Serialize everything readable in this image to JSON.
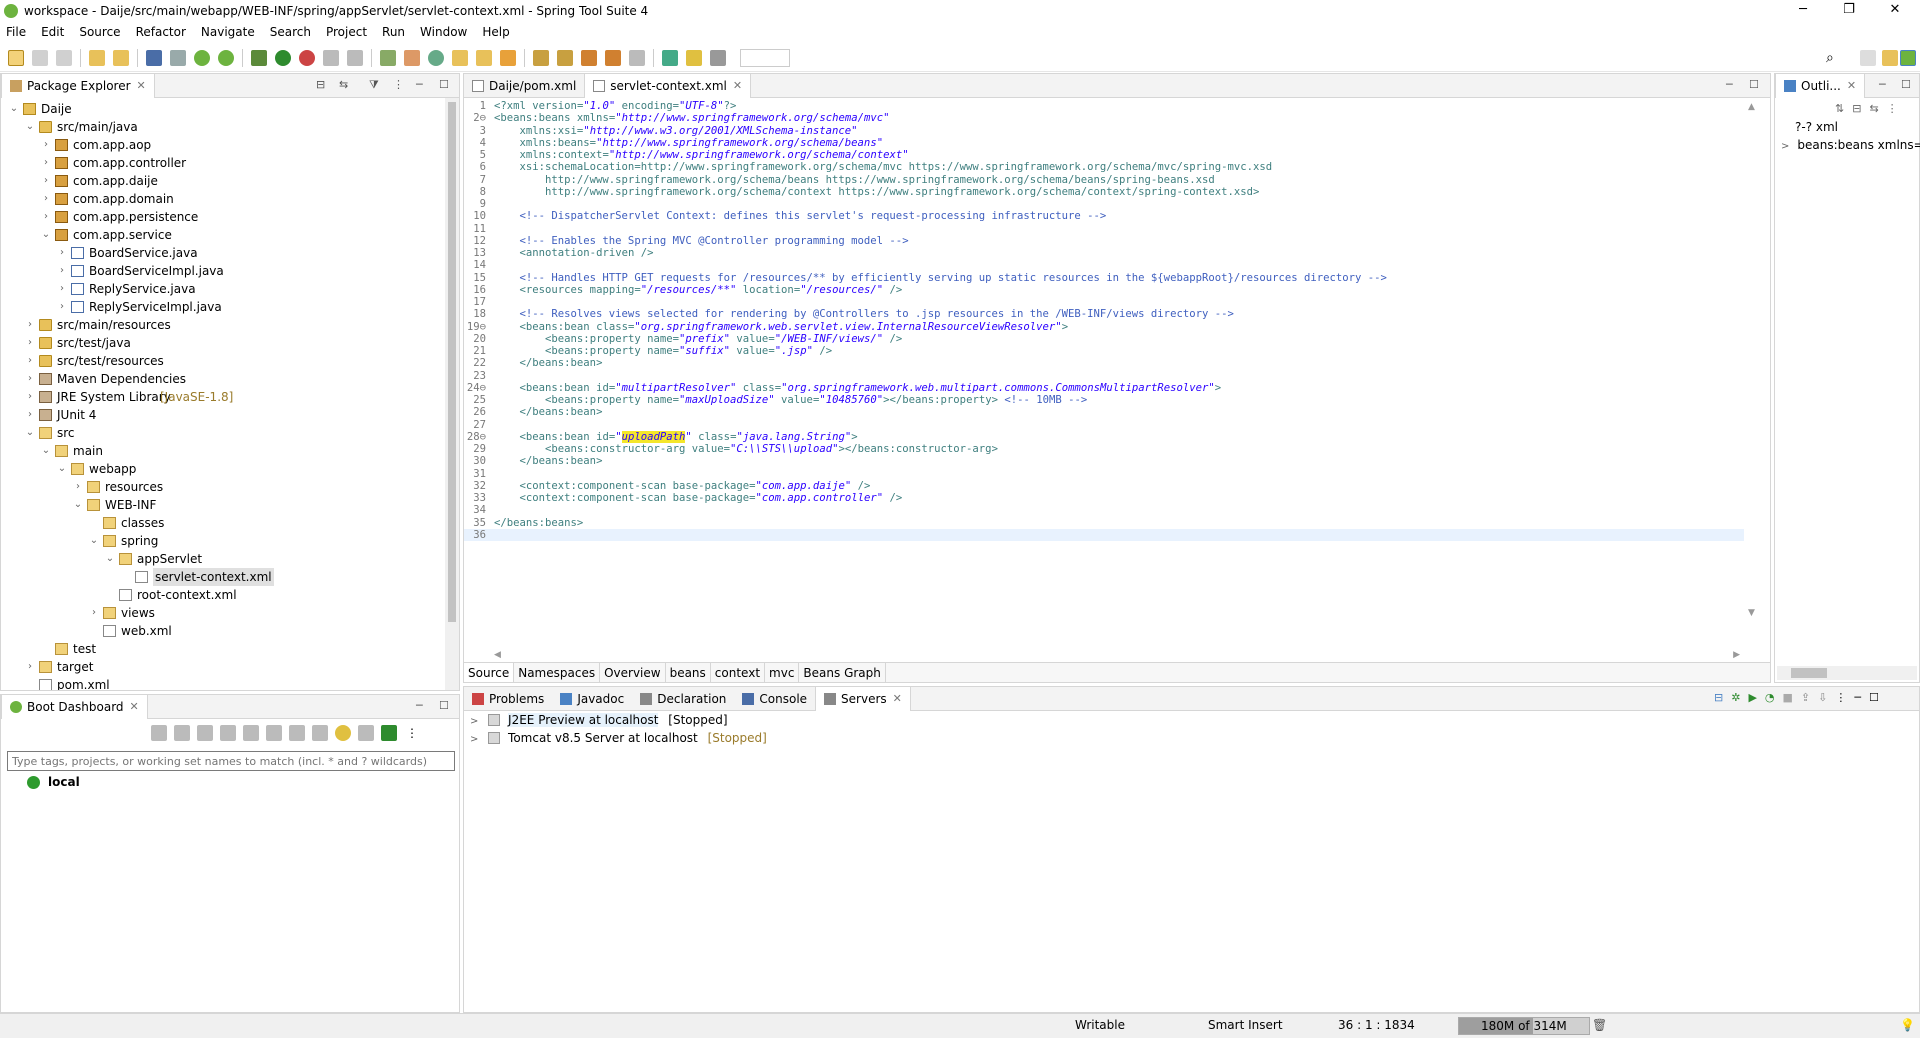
{
  "window": {
    "title": "workspace - Daije/src/main/webapp/WEB-INF/spring/appServlet/servlet-context.xml - Spring Tool Suite 4",
    "minimize": "─",
    "restore": "❐",
    "close": "✕"
  },
  "menu": [
    "File",
    "Edit",
    "Source",
    "Refactor",
    "Navigate",
    "Search",
    "Project",
    "Run",
    "Window",
    "Help"
  ],
  "package_explorer": {
    "title": "Package Explorer",
    "tree": [
      {
        "label": "Daije",
        "depth": 0,
        "icon": "project",
        "arrow": "v"
      },
      {
        "label": "src/main/java",
        "depth": 1,
        "icon": "srcfolder",
        "arrow": "v"
      },
      {
        "label": "com.app.aop",
        "depth": 2,
        "icon": "pkg",
        "arrow": ">"
      },
      {
        "label": "com.app.controller",
        "depth": 2,
        "icon": "pkg",
        "arrow": ">"
      },
      {
        "label": "com.app.daije",
        "depth": 2,
        "icon": "pkg",
        "arrow": ">"
      },
      {
        "label": "com.app.domain",
        "depth": 2,
        "icon": "pkg",
        "arrow": ">"
      },
      {
        "label": "com.app.persistence",
        "depth": 2,
        "icon": "pkg",
        "arrow": ">"
      },
      {
        "label": "com.app.service",
        "depth": 2,
        "icon": "pkg",
        "arrow": "v"
      },
      {
        "label": "BoardService.java",
        "depth": 3,
        "icon": "java",
        "arrow": ">"
      },
      {
        "label": "BoardServiceImpl.java",
        "depth": 3,
        "icon": "java",
        "arrow": ">"
      },
      {
        "label": "ReplyService.java",
        "depth": 3,
        "icon": "java",
        "arrow": ">"
      },
      {
        "label": "ReplyServiceImpl.java",
        "depth": 3,
        "icon": "java",
        "arrow": ">"
      },
      {
        "label": "src/main/resources",
        "depth": 1,
        "icon": "srcfolder",
        "arrow": ">"
      },
      {
        "label": "src/test/java",
        "depth": 1,
        "icon": "srcfolder",
        "arrow": ">"
      },
      {
        "label": "src/test/resources",
        "depth": 1,
        "icon": "srcfolder",
        "arrow": ">"
      },
      {
        "label": "Maven Dependencies",
        "depth": 1,
        "icon": "lib",
        "arrow": ">"
      },
      {
        "label": "JRE System Library",
        "suffix": "[JavaSE-1.8]",
        "depth": 1,
        "icon": "lib",
        "arrow": ">"
      },
      {
        "label": "JUnit 4",
        "depth": 1,
        "icon": "lib",
        "arrow": ">"
      },
      {
        "label": "src",
        "depth": 1,
        "icon": "folder",
        "arrow": "v"
      },
      {
        "label": "main",
        "depth": 2,
        "icon": "folder",
        "arrow": "v"
      },
      {
        "label": "webapp",
        "depth": 3,
        "icon": "folder",
        "arrow": "v"
      },
      {
        "label": "resources",
        "depth": 4,
        "icon": "folder",
        "arrow": ">"
      },
      {
        "label": "WEB-INF",
        "depth": 4,
        "icon": "folder",
        "arrow": "v"
      },
      {
        "label": "classes",
        "depth": 5,
        "icon": "folder",
        "arrow": ""
      },
      {
        "label": "spring",
        "depth": 5,
        "icon": "folder",
        "arrow": "v"
      },
      {
        "label": "appServlet",
        "depth": 6,
        "icon": "folder",
        "arrow": "v"
      },
      {
        "label": "servlet-context.xml",
        "depth": 7,
        "icon": "xml",
        "arrow": "",
        "selected": true
      },
      {
        "label": "root-context.xml",
        "depth": 6,
        "icon": "xml",
        "arrow": ""
      },
      {
        "label": "views",
        "depth": 5,
        "icon": "folder",
        "arrow": ">"
      },
      {
        "label": "web.xml",
        "depth": 5,
        "icon": "xml",
        "arrow": ""
      },
      {
        "label": "test",
        "depth": 2,
        "icon": "folder",
        "arrow": ""
      },
      {
        "label": "target",
        "depth": 1,
        "icon": "folder",
        "arrow": ">"
      },
      {
        "label": "pom.xml",
        "depth": 1,
        "icon": "xml",
        "arrow": ""
      }
    ]
  },
  "boot_dashboard": {
    "title": "Boot Dashboard",
    "filter_placeholder": "Type tags, projects, or working set names to match (incl. * and ? wildcards)",
    "items": [
      "local"
    ]
  },
  "editor": {
    "tabs": [
      {
        "label": "Daije/pom.xml",
        "active": false
      },
      {
        "label": "servlet-context.xml",
        "active": true
      }
    ],
    "bottom_tabs": [
      "Source",
      "Namespaces",
      "Overview",
      "beans",
      "context",
      "mvc",
      "Beans Graph"
    ],
    "lines": [
      {
        "n": "1",
        "t": "<?xml version=\"1.0\" encoding=\"UTF-8\"?>"
      },
      {
        "n": "2⊖",
        "t": "<beans:beans xmlns=\"http://www.springframework.org/schema/mvc\""
      },
      {
        "n": "3",
        "t": "    xmlns:xsi=\"http://www.w3.org/2001/XMLSchema-instance\""
      },
      {
        "n": "4",
        "t": "    xmlns:beans=\"http://www.springframework.org/schema/beans\""
      },
      {
        "n": "5",
        "t": "    xmlns:context=\"http://www.springframework.org/schema/context\""
      },
      {
        "n": "6",
        "t": "    xsi:schemaLocation=\"http://www.springframework.org/schema/mvc https://www.springframework.org/schema/mvc/spring-mvc.xsd"
      },
      {
        "n": "7",
        "t": "        http://www.springframework.org/schema/beans https://www.springframework.org/schema/beans/spring-beans.xsd"
      },
      {
        "n": "8",
        "t": "        http://www.springframework.org/schema/context https://www.springframework.org/schema/context/spring-context.xsd\">"
      },
      {
        "n": "9",
        "t": ""
      },
      {
        "n": "10",
        "t": "    <!-- DispatcherServlet Context: defines this servlet's request-processing infrastructure -->"
      },
      {
        "n": "11",
        "t": ""
      },
      {
        "n": "12",
        "t": "    <!-- Enables the Spring MVC @Controller programming model -->"
      },
      {
        "n": "13",
        "t": "    <annotation-driven />"
      },
      {
        "n": "14",
        "t": ""
      },
      {
        "n": "15",
        "t": "    <!-- Handles HTTP GET requests for /resources/** by efficiently serving up static resources in the ${webappRoot}/resources directory -->"
      },
      {
        "n": "16",
        "t": "    <resources mapping=\"/resources/**\" location=\"/resources/\" />"
      },
      {
        "n": "17",
        "t": ""
      },
      {
        "n": "18",
        "t": "    <!-- Resolves views selected for rendering by @Controllers to .jsp resources in the /WEB-INF/views directory -->"
      },
      {
        "n": "19⊖",
        "t": "    <beans:bean class=\"org.springframework.web.servlet.view.InternalResourceViewResolver\">"
      },
      {
        "n": "20",
        "t": "        <beans:property name=\"prefix\" value=\"/WEB-INF/views/\" />"
      },
      {
        "n": "21",
        "t": "        <beans:property name=\"suffix\" value=\".jsp\" />"
      },
      {
        "n": "22",
        "t": "    </beans:bean>"
      },
      {
        "n": "23",
        "t": ""
      },
      {
        "n": "24⊖",
        "t": "    <beans:bean id=\"multipartResolver\" class=\"org.springframework.web.multipart.commons.CommonsMultipartResolver\">"
      },
      {
        "n": "25",
        "t": "        <beans:property name=\"maxUploadSize\" value=\"10485760\"></beans:property> <!-- 10MB -->"
      },
      {
        "n": "26",
        "t": "    </beans:bean>"
      },
      {
        "n": "27",
        "t": ""
      },
      {
        "n": "28⊖",
        "t": "    <beans:bean id=\"uploadPath\" class=\"java.lang.String\">"
      },
      {
        "n": "29",
        "t": "        <beans:constructor-arg value=\"C:\\\\STS\\\\upload\"></beans:constructor-arg>"
      },
      {
        "n": "30",
        "t": "    </beans:bean>"
      },
      {
        "n": "31",
        "t": ""
      },
      {
        "n": "32",
        "t": "    <context:component-scan base-package=\"com.app.daije\" />"
      },
      {
        "n": "33",
        "t": "    <context:component-scan base-package=\"com.app.controller\" />"
      },
      {
        "n": "34",
        "t": ""
      },
      {
        "n": "35",
        "t": "</beans:beans>"
      },
      {
        "n": "36",
        "t": ""
      }
    ]
  },
  "outline": {
    "title": "Outli...",
    "items": [
      {
        "label": "?-? xml",
        "arrow": ""
      },
      {
        "label": "beans:beans xmlns=",
        "arrow": ">"
      }
    ]
  },
  "bottom_panel": {
    "tabs": [
      "Problems",
      "Javadoc",
      "Declaration",
      "Console",
      "Servers"
    ],
    "servers": [
      {
        "name": "J2EE Preview at localhost",
        "state": "[Stopped]"
      },
      {
        "name": "Tomcat v8.5 Server at localhost",
        "state": "[Stopped]"
      }
    ]
  },
  "status": {
    "writable": "Writable",
    "insert_mode": "Smart Insert",
    "position": "36 : 1 : 1834",
    "heap": "180M of 314M",
    "heap_fraction": 0.573
  },
  "colors": {
    "spring_green": "#6db33f",
    "highlight": "#f5e62a"
  }
}
